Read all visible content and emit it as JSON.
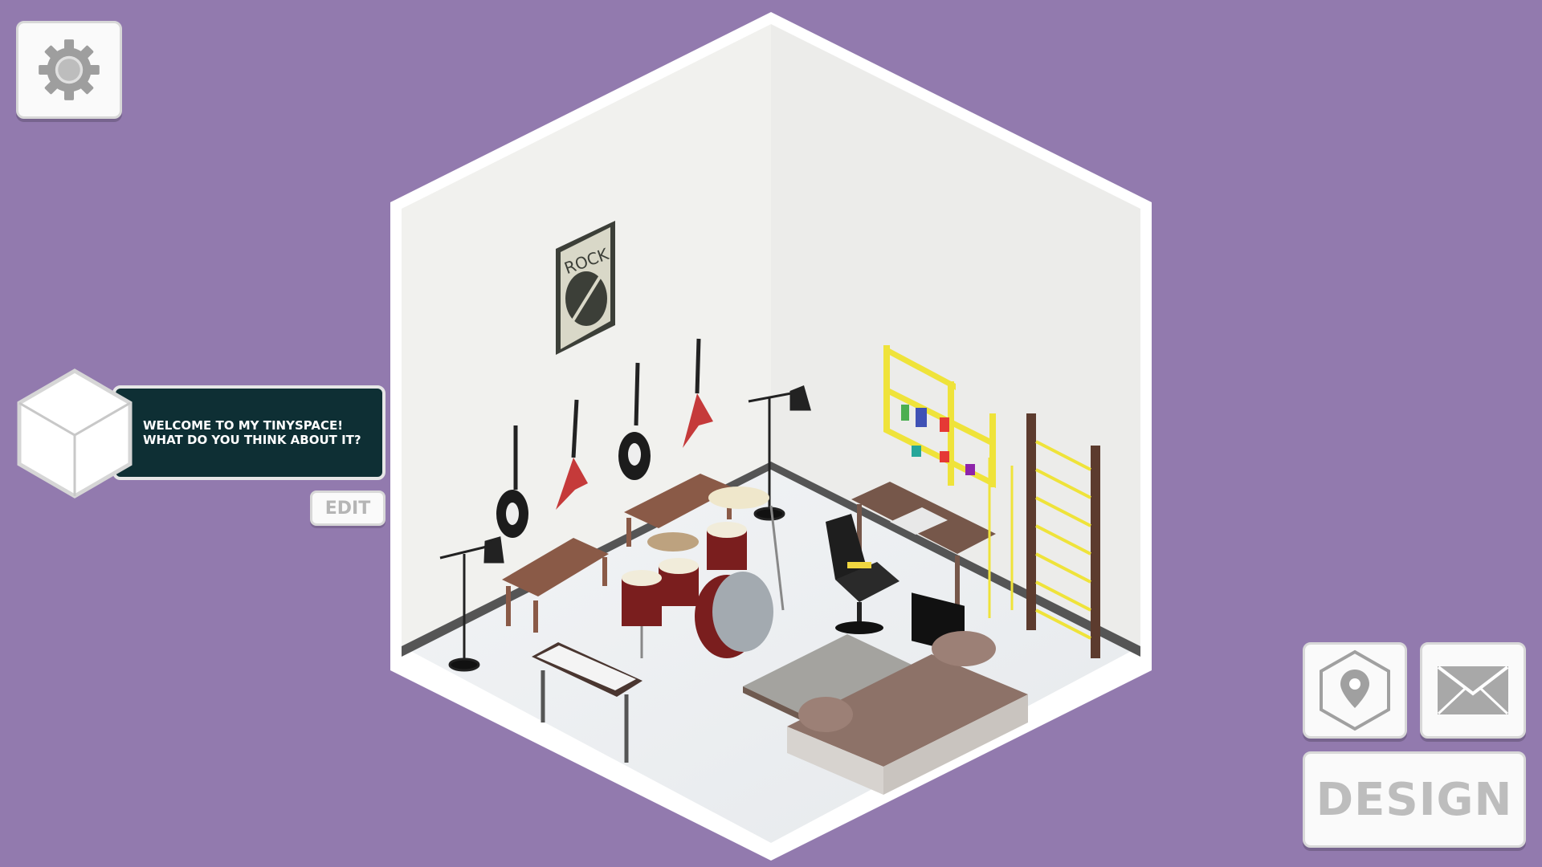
{
  "hud": {
    "settings_icon": "gear-icon",
    "map_icon": "map-pin-hexagon-icon",
    "mail_icon": "envelope-icon",
    "design_label": "DESIGN"
  },
  "speech": {
    "avatar_icon": "cube-hexagon-icon",
    "message": "WELCOME TO MY TINYSPACE! WHAT DO YOU THINK ABOUT IT?",
    "edit_label": "EDIT"
  },
  "room": {
    "poster_text": "ROCK"
  },
  "colors": {
    "background": "#927aae",
    "speech_bubble": "#0e2f34",
    "button_face": "#fafafa"
  }
}
